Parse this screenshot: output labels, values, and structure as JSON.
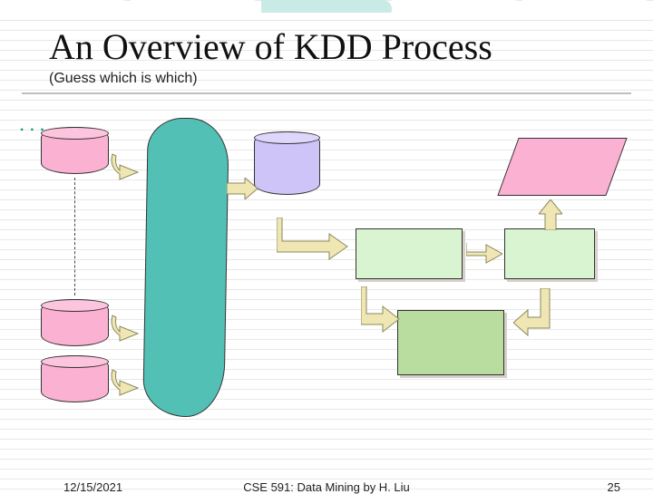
{
  "title": "An Overview of KDD Process",
  "subtitle": "(Guess which is which)",
  "footer": {
    "date": "12/15/2021",
    "course": "CSE 591: Data Mining by H. Liu",
    "page": "25"
  },
  "top_tab_colors": [
    "#ffffff",
    "#ffffff",
    "#c9ebe6",
    "#ffffff",
    "#ffffff"
  ],
  "shapes": {
    "pink_cylinders": 3,
    "purple_cylinders": 1,
    "teal_blob": 1,
    "green_rects": 3,
    "pink_parallelogram": 1,
    "arrows": 9
  }
}
